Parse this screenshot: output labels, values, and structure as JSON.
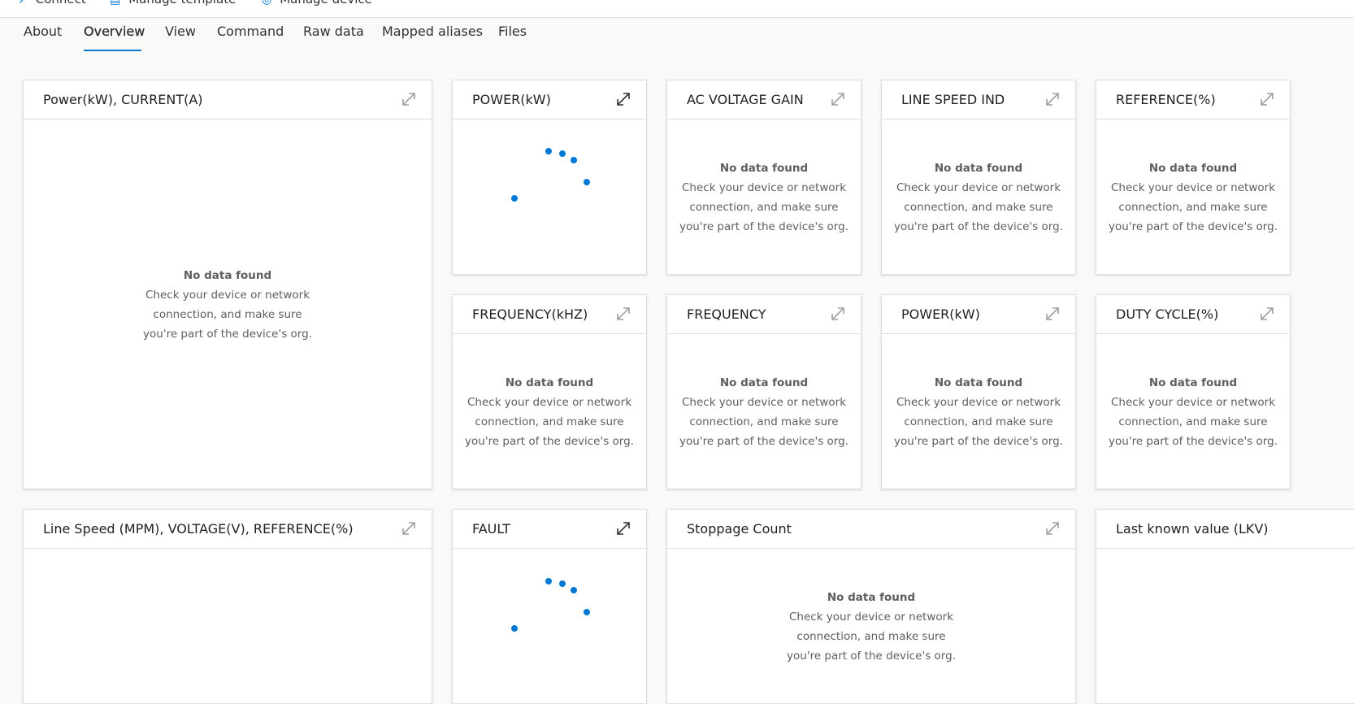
{
  "toolbar": {
    "connect_label": "Connect",
    "manage_template_label": "Manage template",
    "manage_device_label": "Manage device"
  },
  "tabs": [
    {
      "label": "About"
    },
    {
      "label": "Overview"
    },
    {
      "label": "View"
    },
    {
      "label": "Command"
    },
    {
      "label": "Raw data"
    },
    {
      "label": "Mapped aliases"
    },
    {
      "label": "Files"
    }
  ],
  "active_tab": "Overview",
  "empty_state": {
    "heading": "No data found",
    "body": "Check your device or network connection, and make sure you're part of the device's org."
  },
  "tiles": {
    "power_current": {
      "title": "Power(kW), CURRENT(A)"
    },
    "power_kw_1": {
      "title": "POWER(kW)"
    },
    "ac_voltage_gain": {
      "title": "AC VOLTAGE GAIN"
    },
    "line_speed_ind": {
      "title": "LINE SPEED IND"
    },
    "reference": {
      "title": "REFERENCE(%)"
    },
    "frequency_khz": {
      "title": "FREQUENCY(kHZ)"
    },
    "frequency": {
      "title": "FREQUENCY"
    },
    "power_kw_2": {
      "title": "POWER(kW)"
    },
    "duty_cycle": {
      "title": "DUTY CYCLE(%)"
    },
    "line_speed_voltage_ref": {
      "title": "Line Speed (MPM), VOLTAGE(V), REFERENCE(%)"
    },
    "fault": {
      "title": "FAULT"
    },
    "stoppage_count": {
      "title": "Stoppage Count"
    },
    "lkv": {
      "title": "Last known value (LKV)"
    }
  },
  "colors": {
    "accent": "#0078d4",
    "border": "#e1dfdd",
    "muted_text": "#605e5c"
  }
}
